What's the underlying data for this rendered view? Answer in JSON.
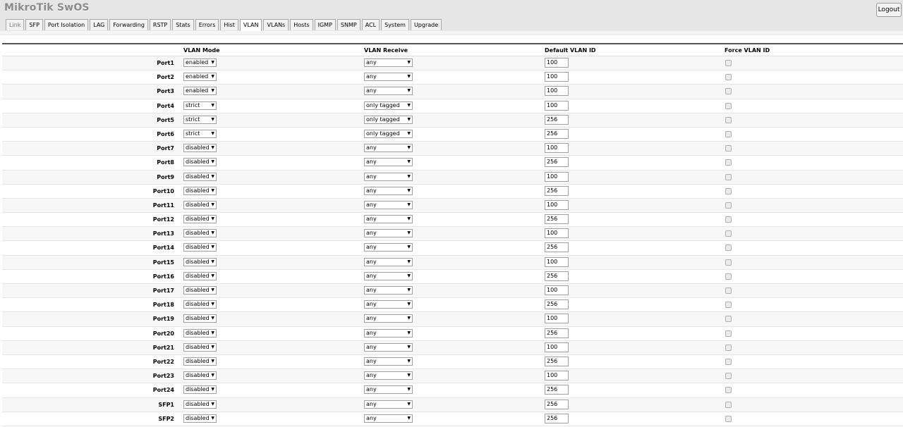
{
  "app": {
    "title": "MikroTik SwOS",
    "logout_label": "Logout"
  },
  "tabs": [
    "Link",
    "SFP",
    "Port Isolation",
    "LAG",
    "Forwarding",
    "RSTP",
    "Stats",
    "Errors",
    "Hist",
    "VLAN",
    "VLANs",
    "Hosts",
    "IGMP",
    "SNMP",
    "ACL",
    "System",
    "Upgrade"
  ],
  "active_tab": "VLAN",
  "columns": {
    "vlan_mode": "VLAN Mode",
    "vlan_receive": "VLAN Receive",
    "default_vlan_id": "Default VLAN ID",
    "force_vlan_id": "Force VLAN ID"
  },
  "rows": [
    {
      "port": "Port1",
      "mode": "enabled",
      "receive": "any",
      "default_id": "100",
      "force": false
    },
    {
      "port": "Port2",
      "mode": "enabled",
      "receive": "any",
      "default_id": "100",
      "force": false
    },
    {
      "port": "Port3",
      "mode": "enabled",
      "receive": "any",
      "default_id": "100",
      "force": false
    },
    {
      "port": "Port4",
      "mode": "strict",
      "receive": "only tagged",
      "default_id": "100",
      "force": false
    },
    {
      "port": "Port5",
      "mode": "strict",
      "receive": "only tagged",
      "default_id": "256",
      "force": false
    },
    {
      "port": "Port6",
      "mode": "strict",
      "receive": "only tagged",
      "default_id": "256",
      "force": false
    },
    {
      "port": "Port7",
      "mode": "disabled",
      "receive": "any",
      "default_id": "100",
      "force": false
    },
    {
      "port": "Port8",
      "mode": "disabled",
      "receive": "any",
      "default_id": "256",
      "force": false
    },
    {
      "port": "Port9",
      "mode": "disabled",
      "receive": "any",
      "default_id": "100",
      "force": false
    },
    {
      "port": "Port10",
      "mode": "disabled",
      "receive": "any",
      "default_id": "256",
      "force": false
    },
    {
      "port": "Port11",
      "mode": "disabled",
      "receive": "any",
      "default_id": "100",
      "force": false
    },
    {
      "port": "Port12",
      "mode": "disabled",
      "receive": "any",
      "default_id": "256",
      "force": false
    },
    {
      "port": "Port13",
      "mode": "disabled",
      "receive": "any",
      "default_id": "100",
      "force": false
    },
    {
      "port": "Port14",
      "mode": "disabled",
      "receive": "any",
      "default_id": "256",
      "force": false
    },
    {
      "port": "Port15",
      "mode": "disabled",
      "receive": "any",
      "default_id": "100",
      "force": false
    },
    {
      "port": "Port16",
      "mode": "disabled",
      "receive": "any",
      "default_id": "256",
      "force": false
    },
    {
      "port": "Port17",
      "mode": "disabled",
      "receive": "any",
      "default_id": "100",
      "force": false
    },
    {
      "port": "Port18",
      "mode": "disabled",
      "receive": "any",
      "default_id": "256",
      "force": false
    },
    {
      "port": "Port19",
      "mode": "disabled",
      "receive": "any",
      "default_id": "100",
      "force": false
    },
    {
      "port": "Port20",
      "mode": "disabled",
      "receive": "any",
      "default_id": "256",
      "force": false
    },
    {
      "port": "Port21",
      "mode": "disabled",
      "receive": "any",
      "default_id": "100",
      "force": false
    },
    {
      "port": "Port22",
      "mode": "disabled",
      "receive": "any",
      "default_id": "256",
      "force": false
    },
    {
      "port": "Port23",
      "mode": "disabled",
      "receive": "any",
      "default_id": "100",
      "force": false
    },
    {
      "port": "Port24",
      "mode": "disabled",
      "receive": "any",
      "default_id": "256",
      "force": false
    },
    {
      "port": "SFP1",
      "mode": "disabled",
      "receive": "any",
      "default_id": "256",
      "force": false
    },
    {
      "port": "SFP2",
      "mode": "disabled",
      "receive": "any",
      "default_id": "256",
      "force": false
    }
  ],
  "icons": {
    "dropdown": "triangle-down-icon"
  }
}
